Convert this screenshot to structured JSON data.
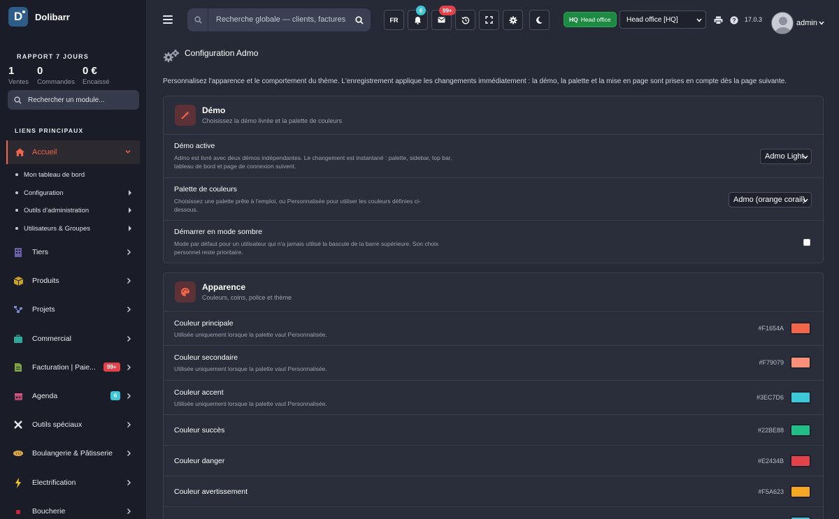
{
  "brand": {
    "name": "Dolibarr",
    "logo_letter": "D"
  },
  "sidebar": {
    "report_title": "RAPPORT 7 JOURS",
    "stats": [
      {
        "value": "1",
        "label": "Ventes"
      },
      {
        "value": "0",
        "label": "Commandes"
      },
      {
        "value": "0 €",
        "label": "Encaissé"
      }
    ],
    "search_placeholder": "Rechercher un module...",
    "links_title": "LIENS PRINCIPAUX",
    "active": {
      "label": "Accueil"
    },
    "subitems": [
      {
        "label": "Mon tableau de bord"
      },
      {
        "label": "Configuration"
      },
      {
        "label": "Outils d'administration"
      },
      {
        "label": "Utilisateurs & Groupes"
      }
    ],
    "items": [
      {
        "label": "Tiers",
        "icon": "building-icon"
      },
      {
        "label": "Produits",
        "icon": "box-icon"
      },
      {
        "label": "Projets",
        "icon": "project-icon"
      },
      {
        "label": "Commercial",
        "icon": "briefcase-icon"
      },
      {
        "label": "Facturation | Paie...",
        "icon": "invoice-icon",
        "badge": "99+"
      },
      {
        "label": "Agenda",
        "icon": "calendar-icon",
        "badge": "6"
      },
      {
        "label": "Outils spéciaux",
        "icon": "tools-icon"
      },
      {
        "label": "Boulangerie & Pâtisserie",
        "icon": "bread-icon"
      },
      {
        "label": "Electrification",
        "icon": "bolt-icon"
      },
      {
        "label": "Boucherie",
        "icon": "meat-icon"
      }
    ]
  },
  "topbar": {
    "search_placeholder": "Recherche globale — clients, factures",
    "lang": "FR",
    "notif_count": "6",
    "mail_count": "99+",
    "hq_code": "HQ",
    "hq_label": "Head office",
    "entity": "Head office [HQ]",
    "version": "17.0.3",
    "user": "admin"
  },
  "page": {
    "title": "Configuration Admo",
    "intro": "Personnalisez l'apparence et le comportement du thème. L'enregistrement applique les changements immédiatement : la démo, la palette et la mise en page sont prises en compte dès la page suivante."
  },
  "demo_card": {
    "title": "Démo",
    "subtitle": "Choisissez la démo livrée et la palette de couleurs",
    "rows": [
      {
        "label": "Démo active",
        "desc": "Admo est livré avec deux démos indépendantes. Le changement est instantané : palette, sidebar, top bar, tableau de bord et page de connexion suivent.",
        "value": "Admo Light"
      },
      {
        "label": "Palette de couleurs",
        "desc": "Choisissez une palette prête à l'emploi, ou Personnalisée pour utiliser les couleurs définies ci-dessous.",
        "value": "Admo (orange corail)"
      },
      {
        "label": "Démarrer en mode sombre",
        "desc": "Mode par défaut pour un utilisateur qui n'a jamais utilisé la bascule de la barre supérieure. Son choix personnel reste prioritaire.",
        "checked": false
      }
    ]
  },
  "appearance_card": {
    "title": "Apparence",
    "subtitle": "Couleurs, coins, police et thème",
    "colors": [
      {
        "label": "Couleur principale",
        "desc": "Utilisée uniquement lorsque la palette vaut Personnalisée.",
        "hex": "#F1654A"
      },
      {
        "label": "Couleur secondaire",
        "desc": "Utilisée uniquement lorsque la palette vaut Personnalisée.",
        "hex": "#F79079"
      },
      {
        "label": "Couleur accent",
        "desc": "Utilisée uniquement lorsque la palette vaut Personnalisée.",
        "hex": "#3EC7D6"
      },
      {
        "label": "Couleur succès",
        "desc": "",
        "hex": "#22BE88"
      },
      {
        "label": "Couleur danger",
        "desc": "",
        "hex": "#E2434B"
      },
      {
        "label": "Couleur avertissement",
        "desc": "",
        "hex": "#F5A623"
      }
    ]
  },
  "colors": {
    "accent": "#F1654A",
    "bg": "#262a36",
    "sidebar": "#1a1d27",
    "cyan_badge": "#3EC7D6",
    "green": "#1d8a44"
  }
}
